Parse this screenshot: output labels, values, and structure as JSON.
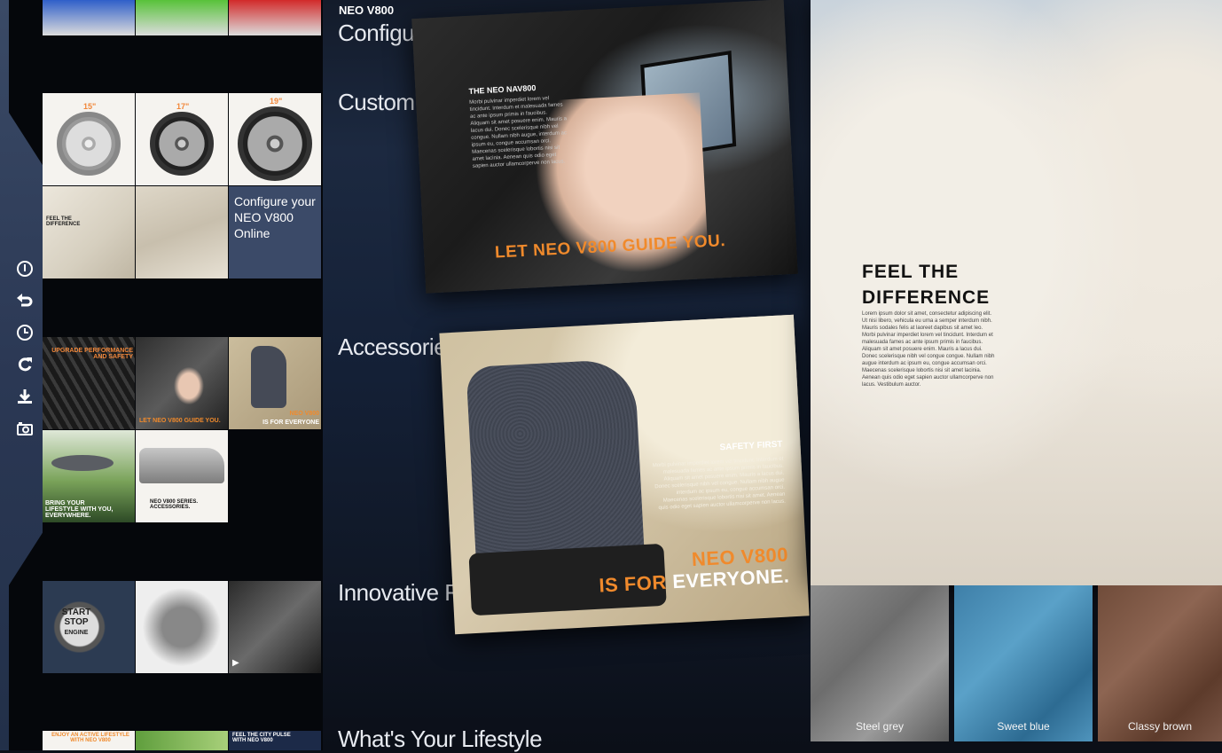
{
  "app": {
    "brand": "NEO V800"
  },
  "toolbar": {
    "items": [
      {
        "name": "info-icon"
      },
      {
        "name": "back-icon"
      },
      {
        "name": "history-icon"
      },
      {
        "name": "refresh-icon"
      },
      {
        "name": "download-icon"
      },
      {
        "name": "camera-icon"
      }
    ]
  },
  "thumbnails": {
    "wheel_sizes": [
      "15\"",
      "17\"",
      "19\""
    ],
    "configure_link": "Configure your NEO V800 Online",
    "seat_thumb_caption": "FEEL THE DIFFERENCE",
    "tire_caption": "UPGRADE PERFORMANCE AND SAFETY",
    "nav_thumb_caption": "LET NEO V800 GUIDE YOU.",
    "kid_thumb_caption_1": "NEO V800",
    "kid_thumb_caption_2": "IS FOR EVERYONE",
    "roofbox_caption": "BRING YOUR LIFESTYLE WITH YOU, EVERYWHERE.",
    "accessories_caption": "NEO V800 SERIES. ACCESSORIES.",
    "start_stop": [
      "START",
      "STOP",
      "ENGINE"
    ],
    "lifestyle_caption_1": "ENJOY AN ACTIVE LIFESTYLE WITH NEO V800",
    "lifestyle_caption_2": "FEEL THE CITY PULSE WITH NEO V800"
  },
  "sections": {
    "configure": "Configu",
    "customize": "Custom",
    "accessories": "Accessories",
    "innovative": "Innovative Fe",
    "lifestyle": "What's Your Lifestyle"
  },
  "cards": {
    "nav": {
      "heading": "THE NEO NAV800",
      "body": "Morbi pulvinar imperdiet lorem vel tincidunt. Interdum et malesuada fames ac ante ipsum primis in faucibus. Aliquam sit amet posuere enim. Mauris a lacus dui. Donec scelerisque nibh vel congue. Nullam nibh augue, interdum ac ipsum eu, congue accumsan orci. Maecenas scelerisque lobortis nisi sit amet lacinia. Aenean quis odio eget sapien auctor ullamcorperve non lacus.",
      "slogan": "LET NEO V800 GUIDE YOU."
    },
    "seat": {
      "heading": "SAFETY FIRST",
      "body": "Morbi pulvinar imperdiet lorem vel tincidunt. Interdum et malesuada fames ac ante ipsum primis in faucibus. Aliquam sit amet posuere enim. Mauris a lacus dui. Donec scelerisque nibh vel congue. Nullam nibh augue interdum ac ipsum eu, congue accumsan orci. Maecenas scelerisque lobortis nisi sit amet. Aenean quis odio eget sapien auctor ullamcorperve non lacus.",
      "slogan_line1": "NEO V800",
      "slogan_line2_accent": "IS FOR",
      "slogan_line2": "EVERYONE."
    }
  },
  "hero": {
    "title_line1": "FEEL THE",
    "title_line2": "DIFFERENCE",
    "body": "Lorem ipsum dolor sit amet, consectetur adipiscing elit. Ut nisi libero, vehicula eu urna a semper interdum nibh. Mauris sodales felis at laoreet dapibus sit amet leo. Morbi pulvinar imperdiet lorem vel tincidunt. Interdum et malesuada fames ac ante ipsum primis in faucibus. Aliquam sit amet posuere enim. Mauris a lacus dui. Donec scelerisque nibh vel congue congue. Nullam nibh augue interdum ac ipsum eu, congue accumsan orci. Maecenas scelerisque lobortis nisi sit amet lacinia. Aenean quis odio eget sapien auctor ullamcorperve non lacus. Vestibulum auctor.",
    "swatches": [
      "Steel grey",
      "Sweet blue",
      "Classy brown"
    ]
  }
}
